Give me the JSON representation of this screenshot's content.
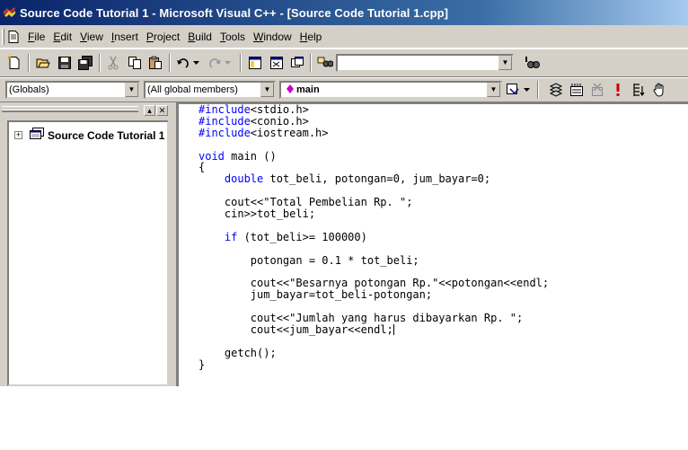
{
  "window": {
    "title": "Source Code Tutorial 1 - Microsoft Visual C++ - [Source Code Tutorial 1.cpp]"
  },
  "menu": {
    "items": [
      {
        "accel": "F",
        "rest": "ile"
      },
      {
        "accel": "E",
        "rest": "dit"
      },
      {
        "accel": "V",
        "rest": "iew"
      },
      {
        "accel": "I",
        "rest": "nsert"
      },
      {
        "accel": "P",
        "rest": "roject"
      },
      {
        "accel": "B",
        "rest": "uild"
      },
      {
        "accel": "T",
        "rest": "ools"
      },
      {
        "accel": "W",
        "rest": "indow"
      },
      {
        "accel": "H",
        "rest": "elp"
      }
    ]
  },
  "toolbar2": {
    "scope": "(Globals)",
    "members": "(All global members)",
    "function": "main"
  },
  "workspace": {
    "tree_root": "Source Code Tutorial 1"
  },
  "editor": {
    "lines": [
      {
        "indent": "",
        "kw": "#include",
        "text": "<stdio.h>"
      },
      {
        "indent": "",
        "kw": "#include",
        "text": "<conio.h>"
      },
      {
        "indent": "",
        "kw": "#include",
        "text": "<iostream.h>"
      },
      {
        "indent": "",
        "kw": "",
        "text": ""
      },
      {
        "indent": "",
        "kw": "void",
        "text": " main ()"
      },
      {
        "indent": "",
        "kw": "",
        "text": "{"
      },
      {
        "indent": "    ",
        "kw": "double",
        "text": " tot_beli, potongan=0, jum_bayar=0;"
      },
      {
        "indent": "",
        "kw": "",
        "text": ""
      },
      {
        "indent": "    ",
        "kw": "",
        "text": "cout<<\"Total Pembelian Rp. \";"
      },
      {
        "indent": "    ",
        "kw": "",
        "text": "cin>>tot_beli;"
      },
      {
        "indent": "",
        "kw": "",
        "text": ""
      },
      {
        "indent": "    ",
        "kw": "if",
        "text": " (tot_beli>= 100000)"
      },
      {
        "indent": "",
        "kw": "",
        "text": ""
      },
      {
        "indent": "        ",
        "kw": "",
        "text": "potongan = 0.1 * tot_beli;"
      },
      {
        "indent": "",
        "kw": "",
        "text": ""
      },
      {
        "indent": "        ",
        "kw": "",
        "text": "cout<<\"Besarnya potongan Rp.\"<<potongan<<endl;"
      },
      {
        "indent": "        ",
        "kw": "",
        "text": "jum_bayar=tot_beli-potongan;"
      },
      {
        "indent": "",
        "kw": "",
        "text": ""
      },
      {
        "indent": "        ",
        "kw": "",
        "text": "cout<<\"Jumlah yang harus dibayarkan Rp. \";"
      },
      {
        "indent": "        ",
        "kw": "",
        "text": "cout<<jum_bayar<<endl;"
      },
      {
        "indent": "",
        "kw": "",
        "text": ""
      },
      {
        "indent": "    ",
        "kw": "",
        "text": "getch();"
      },
      {
        "indent": "",
        "kw": "",
        "text": "}"
      }
    ],
    "caret_line": 19
  },
  "colors": {
    "keyword": "#0000ff",
    "title_gradient_start": "#0a246a",
    "title_gradient_end": "#a6caf0",
    "chrome": "#d4d0c8"
  },
  "icons": {
    "app": "vc-app-icon",
    "document": "document-icon",
    "function": "function-diamond-icon"
  }
}
